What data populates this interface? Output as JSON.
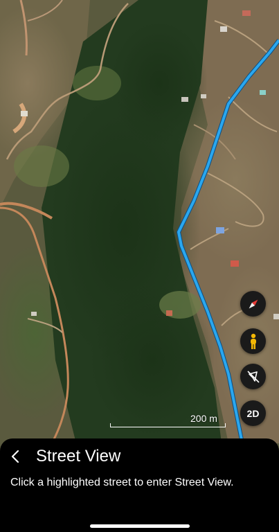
{
  "map": {
    "type": "satellite",
    "highlighted_street_color": "#2aa7ef"
  },
  "scale": {
    "label": "200 m"
  },
  "controls": {
    "compass_icon": "compass-icon",
    "pegman_icon": "pegman-icon",
    "layers_off_icon": "layers-off-icon",
    "view_mode_label": "2D",
    "pegman_color": "#f2b705"
  },
  "sheet": {
    "back_icon": "chevron-left-icon",
    "title": "Street View",
    "body": "Click a highlighted street to enter Street View."
  }
}
